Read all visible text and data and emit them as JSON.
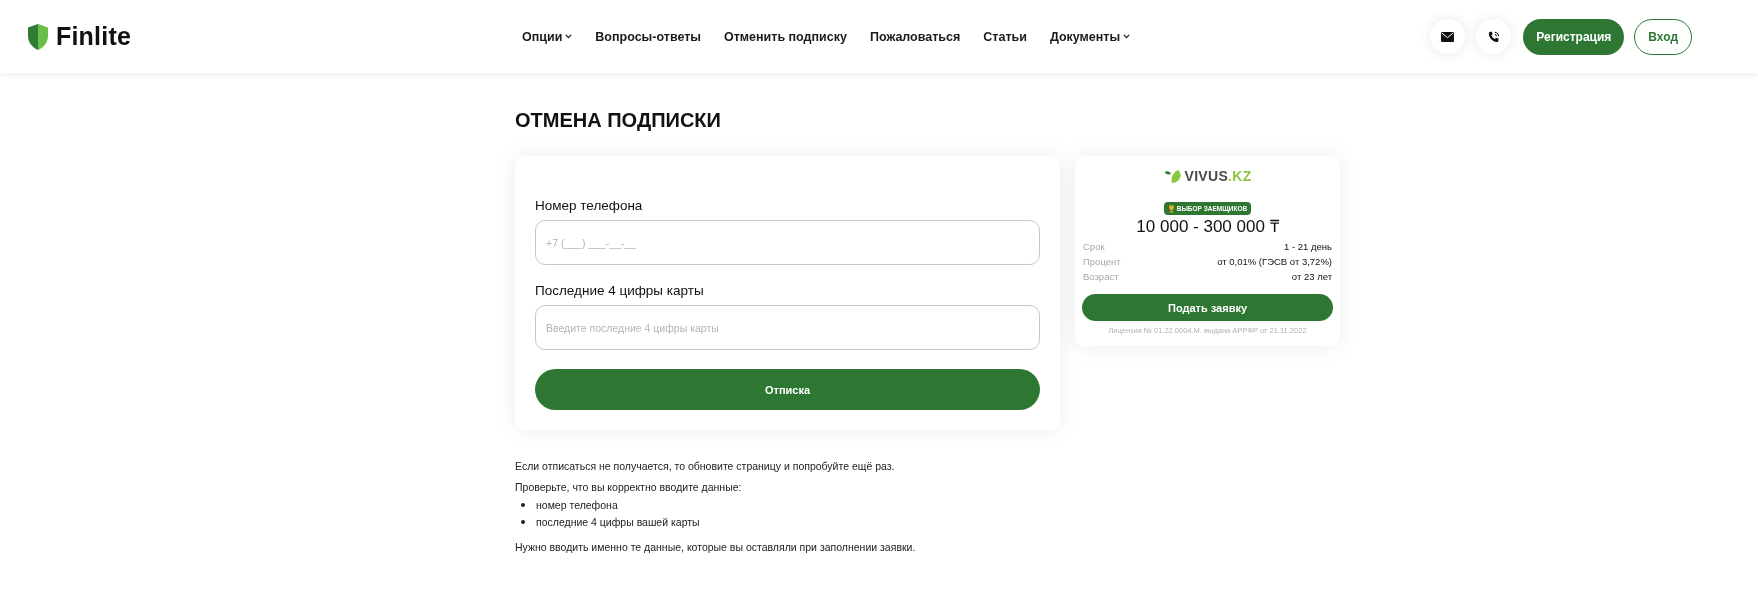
{
  "header": {
    "logo": "Finlite",
    "nav": [
      {
        "label": "Опции",
        "dropdown": true
      },
      {
        "label": "Вопросы-ответы",
        "dropdown": false
      },
      {
        "label": "Отменить подписку",
        "dropdown": false
      },
      {
        "label": "Пожаловаться",
        "dropdown": false
      },
      {
        "label": "Статьи",
        "dropdown": false
      },
      {
        "label": "Документы",
        "dropdown": true
      }
    ],
    "register_button": "Регистрация",
    "login_button": "Вход"
  },
  "page_title": "ОТМЕНА ПОДПИСКИ",
  "form": {
    "fields": [
      {
        "label": "Номер телефона",
        "placeholder": "+7 (___) ___-__-__"
      },
      {
        "label": "Последние 4 цифры карты",
        "placeholder": "Введите последние 4 цифры карты"
      }
    ],
    "submit": "Отписка"
  },
  "offer": {
    "logo": {
      "name": "VIVUS",
      "suffix": ".KZ"
    },
    "badge": "ВЫБОР ЗАЕМЩИКОВ",
    "amount": "10 000 - 300 000 ₸",
    "terms": [
      {
        "label": "Срок",
        "value": "1 - 21 день"
      },
      {
        "label": "Процент",
        "value": "от 0,01% (ГЭСВ от 3,72%)"
      },
      {
        "label": "Возраст",
        "value": "от 23 лет"
      }
    ],
    "button": "Подать заявку",
    "license": "Лицензия № 01.22.0004.M. выдана АРРФР от 21.11.2022"
  },
  "help": {
    "intro": "Если отписаться не получается, то обновите страницу и попробуйте ещё раз.",
    "check": "Проверьте, что вы корректно вводите данные:",
    "items": [
      "номер телефона",
      "последние 4 цифры вашей карты"
    ],
    "note": "Нужно вводить именно те данные, которые вы оставляли при заполнении заявки."
  }
}
